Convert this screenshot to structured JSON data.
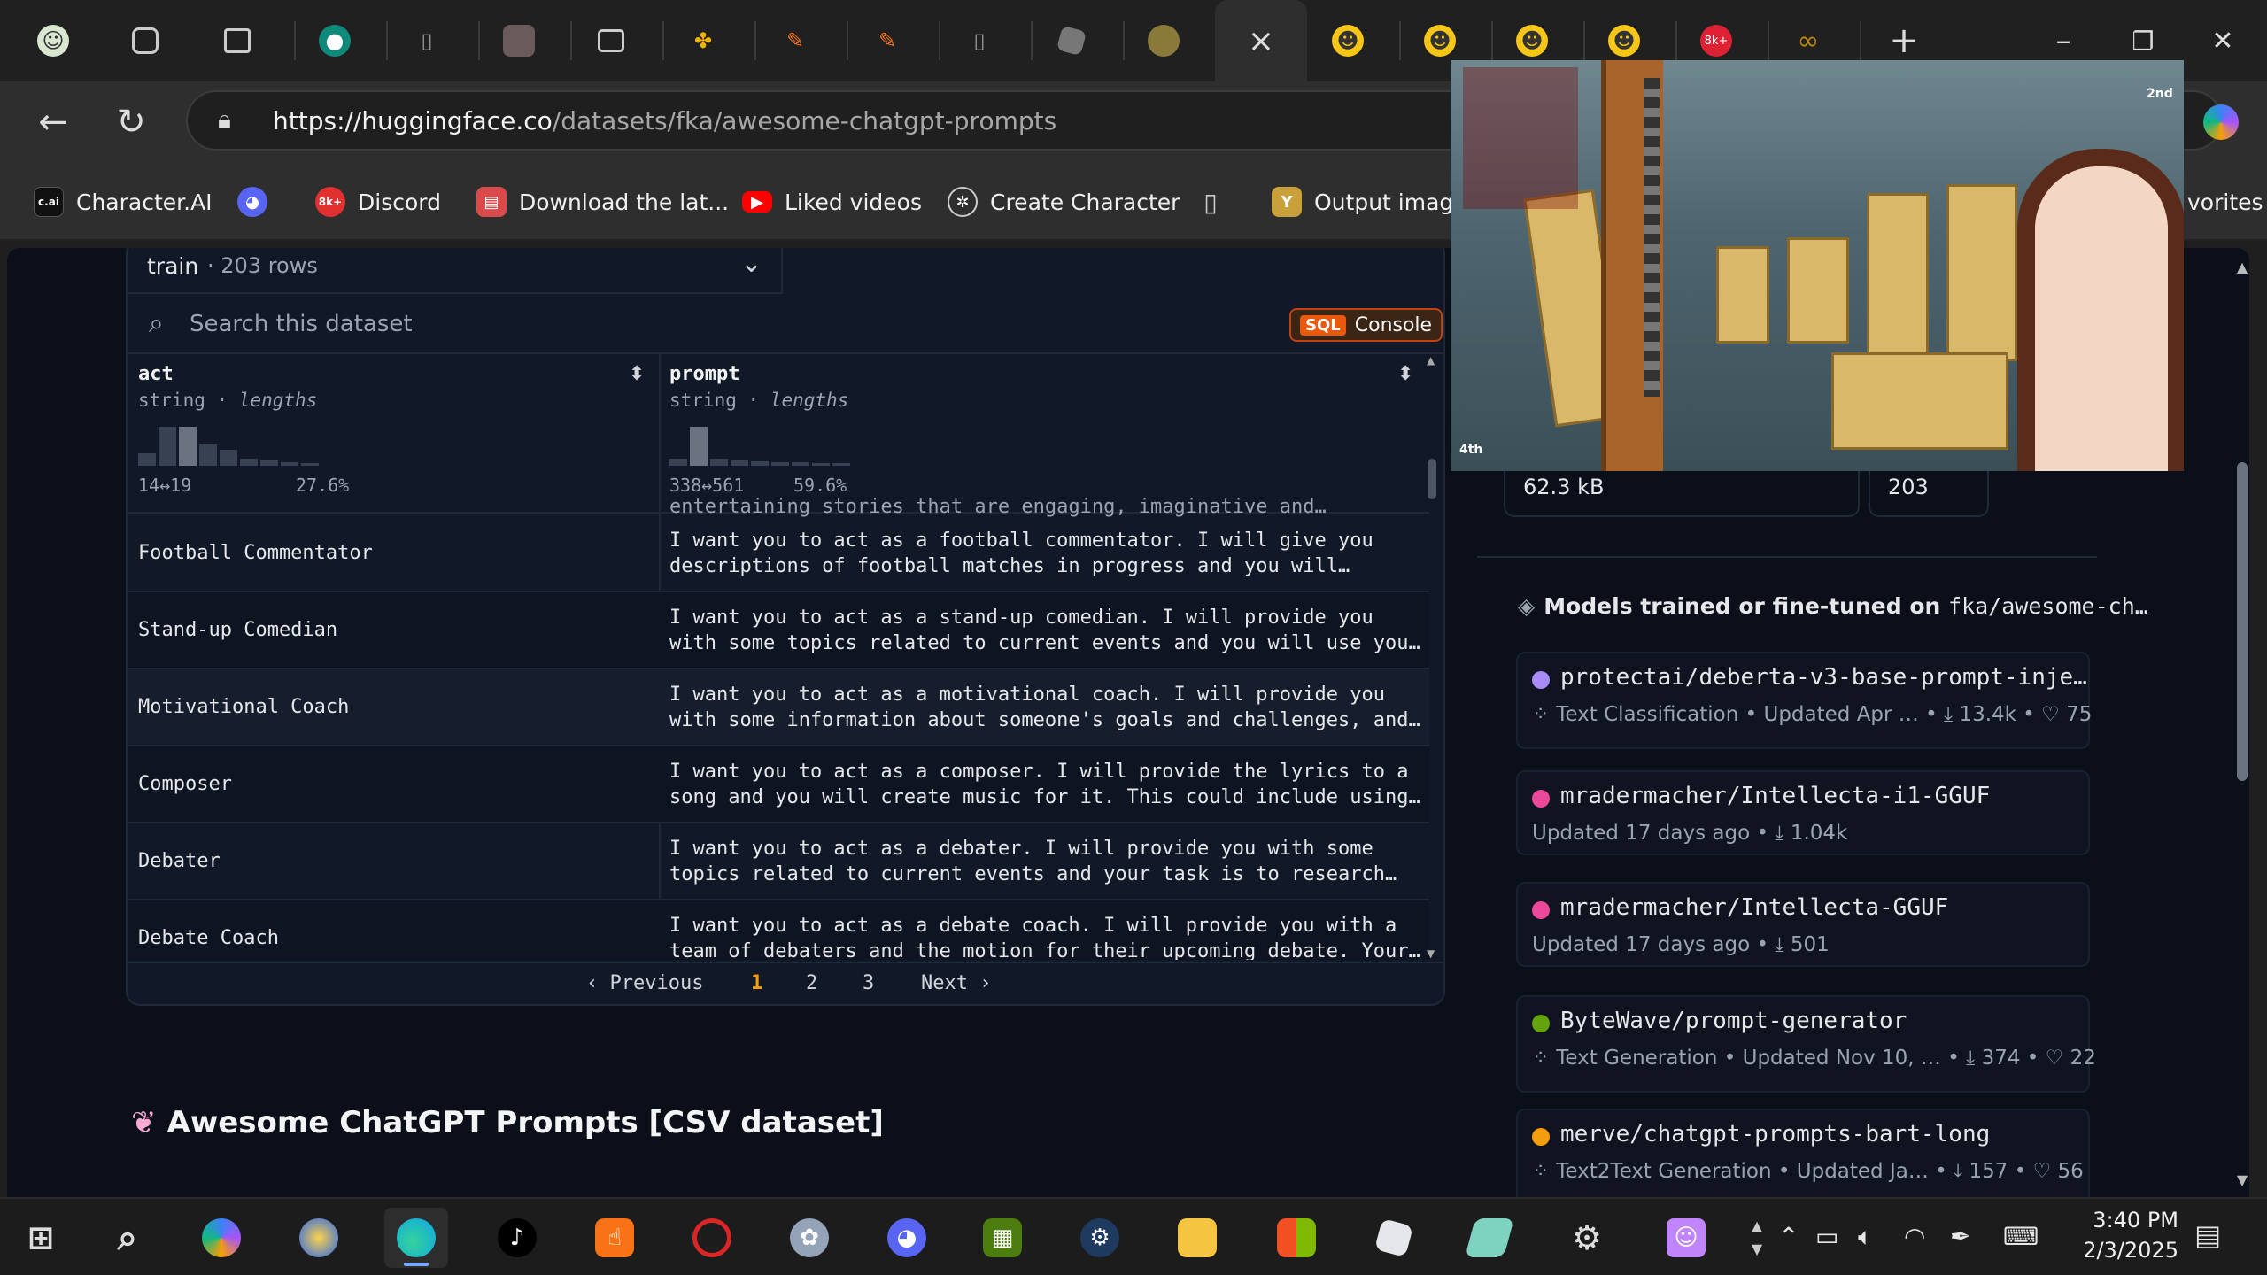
{
  "browser": {
    "url_host": "https://huggingface.co",
    "url_path": "/datasets/fka/awesome-chatgpt-prompts",
    "close_tab": "×",
    "new_tab": "+",
    "minimize": "–",
    "restore": "❐",
    "close_window": "✕"
  },
  "bookmarks": [
    {
      "label": "Character.AI",
      "icon": "c.ai",
      "color": "#111111"
    },
    {
      "label": "",
      "icon": "discord-icon",
      "color": "#5865f2"
    },
    {
      "label": "Discord",
      "icon": "8k+",
      "color": "#e03030"
    },
    {
      "label": "Download the lat...",
      "icon": "store-icon",
      "color": "#d94a4a"
    },
    {
      "label": "Liked videos",
      "icon": "youtube-icon",
      "color": "#ff0000"
    },
    {
      "label": "Create Character",
      "icon": "openai-icon",
      "color": "#444444"
    },
    {
      "label": "",
      "icon": "page-icon",
      "color": "#444444"
    },
    {
      "label": "Output image",
      "icon": "Y",
      "color": "#c9a13a"
    },
    {
      "label": "vorites",
      "icon": "",
      "color": ""
    }
  ],
  "dataset": {
    "split": "train",
    "rows": "203 rows",
    "search_placeholder": "Search this dataset",
    "sql_tag": "SQL",
    "sql_label": "Console",
    "columns": [
      {
        "name": "act",
        "type": "string",
        "stat": "lengths",
        "range": "14↔19",
        "pct": "27.6%"
      },
      {
        "name": "prompt",
        "type": "string",
        "stat": "lengths",
        "range": "338↔561",
        "pct": "59.6%"
      }
    ],
    "partial_row": "entertaining stories that are engaging, imaginative and…",
    "rows_data": [
      {
        "act": "Football Commentator",
        "prompt": "I want you to act as a football commentator. I will give you\ndescriptions of football matches in progress and you will…"
      },
      {
        "act": "Stand-up Comedian",
        "prompt": "I want you to act as a stand-up comedian. I will provide you\nwith some topics related to current events and you will use you…"
      },
      {
        "act": "Motivational Coach",
        "prompt": "I want you to act as a motivational coach. I will provide you\nwith some information about someone's goals and challenges, and…"
      },
      {
        "act": "Composer",
        "prompt": "I want you to act as a composer. I will provide the lyrics to a\nsong and you will create music for it. This could include using…"
      },
      {
        "act": "Debater",
        "prompt": "I want you to act as a debater. I will provide you with some\ntopics related to current events and your task is to research…"
      },
      {
        "act": "Debate Coach",
        "prompt": "I want you to act as a debate coach. I will provide you with a\nteam of debaters and the motion for their upcoming debate. Your…"
      }
    ],
    "pager": {
      "prev": "‹  Previous",
      "p1": "1",
      "p2": "2",
      "p3": "3",
      "next": "Next  ›"
    },
    "readme_title": "Awesome ChatGPT Prompts [CSV dataset]"
  },
  "sidebar": {
    "size": "62.3 kB",
    "count": "203",
    "models_head_prefix": "Models trained or fine-tuned on",
    "models_head_repo": "fka/awesome-ch…",
    "models": [
      {
        "name": "protectai/deberta-v3-base-prompt-inje…",
        "meta": "Text Classification  •  Updated Apr …  •  ⤓ 13.4k  •  ♡ 75",
        "dot": "#a78bfa"
      },
      {
        "name": "mradermacher/Intellecta-i1-GGUF",
        "meta": "Updated 17 days ago  •  ⤓ 1.04k",
        "dot": "#ec4899"
      },
      {
        "name": "mradermacher/Intellecta-GGUF",
        "meta": "Updated 17 days ago  •  ⤓ 501",
        "dot": "#ec4899"
      },
      {
        "name": "ByteWave/prompt-generator",
        "meta": "Text Generation  •  Updated Nov 10, …  •  ⤓ 374  •  ♡ 22",
        "dot": "#65a30d"
      },
      {
        "name": "merve/chatgpt-prompts-bart-long",
        "meta": "Text2Text Generation  •  Updated Ja…  •  ⤓ 157  •  ♡ 56",
        "dot": "#f59e0b"
      }
    ]
  },
  "video": {
    "rank_left": "4th",
    "rank_right": "2nd"
  },
  "taskbar": {
    "time": "3:40 PM",
    "date": "2/3/2025"
  }
}
